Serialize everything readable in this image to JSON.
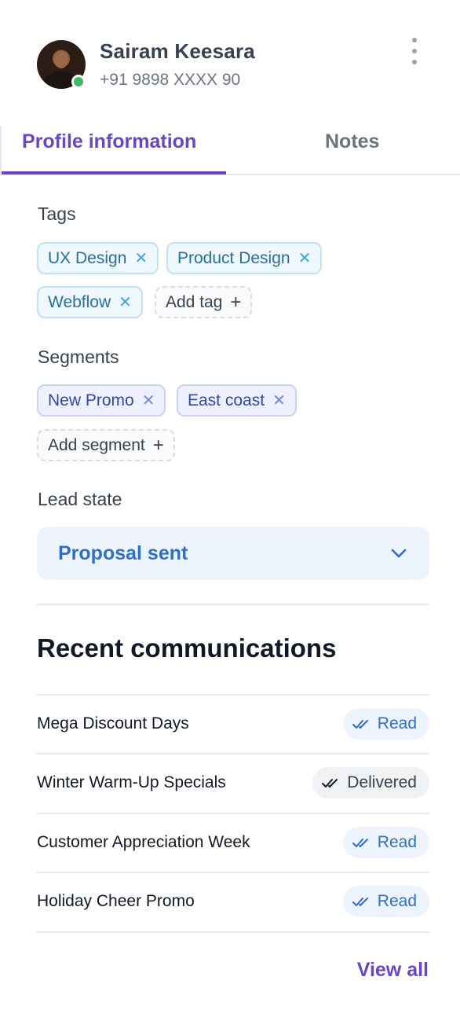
{
  "contact": {
    "name": "Sairam Keesara",
    "phone": "+91 9898 XXXX 90",
    "status_color": "#3fb86a"
  },
  "tabs": [
    {
      "label": "Profile information",
      "active": true
    },
    {
      "label": "Notes",
      "active": false
    }
  ],
  "accent_color": "#6b46c1",
  "tags": {
    "label": "Tags",
    "items": [
      "UX Design",
      "Product Design",
      "Webflow"
    ],
    "add_label": "Add tag"
  },
  "segments": {
    "label": "Segments",
    "items": [
      "New Promo",
      "East coast"
    ],
    "add_label": "Add segment"
  },
  "lead_state": {
    "label": "Lead state",
    "value": "Proposal sent"
  },
  "recent_communications": {
    "title": "Recent communications",
    "items": [
      {
        "name": "Mega Discount Days",
        "status": "Read"
      },
      {
        "name": "Winter Warm-Up Specials",
        "status": "Delivered"
      },
      {
        "name": "Customer Appreciation Week",
        "status": "Read"
      },
      {
        "name": "Holiday Cheer Promo",
        "status": "Read"
      }
    ],
    "view_all_label": "View all"
  },
  "icons": {
    "more": "more-vertical-icon",
    "remove": "close-icon",
    "add": "plus-icon",
    "dropdown": "chevron-down-icon",
    "status": "double-check-icon"
  }
}
